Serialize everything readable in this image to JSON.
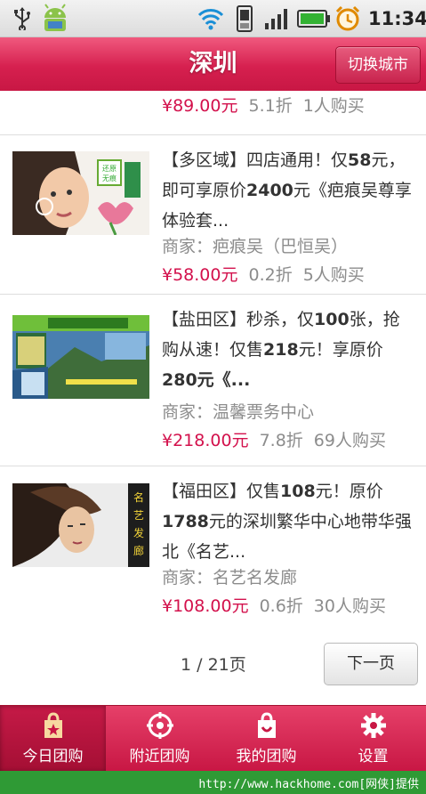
{
  "status_bar": {
    "time": "11:34",
    "icons": [
      "usb-icon",
      "android-debug-icon",
      "wifi-icon",
      "phone-icon",
      "signal-icon",
      "battery-icon",
      "alarm-clock-icon"
    ]
  },
  "header": {
    "city": "深圳",
    "switch_city_label": "切换城市"
  },
  "partial_item": {
    "price": "¥89.00元",
    "discount": "5.1折",
    "buyers": "1人购买"
  },
  "deals": [
    {
      "title_prefix": "【多区域】四店通用！仅",
      "title_num1": "58",
      "title_mid1": "元，即可享原价",
      "title_num2": "2400",
      "title_rest": "元《疤痕吴尊享体验套...",
      "merchant": "商家：疤痕吴（巴恒吴）",
      "price": "¥58.00元",
      "discount": "0.2折",
      "buyers": "5人购买",
      "image": "scar-treatment-promo"
    },
    {
      "title_prefix": "【盐田区】秒杀，仅",
      "title_num1": "100",
      "title_mid1": "张，抢购从速！仅售",
      "title_num2": "218",
      "title_rest": "元！享原价",
      "title_num3": "280",
      "title_end": "元《...",
      "merchant": "商家：温馨票务中心",
      "price": "¥218.00元",
      "discount": "7.8折",
      "buyers": "69人购买",
      "image": "scenic-tour-tickets"
    },
    {
      "title_prefix": "【福田区】仅售",
      "title_num1": "108",
      "title_mid1": "元！原价",
      "title_num2": "1788",
      "title_rest": "元的深圳繁华中心地带华强北《名艺...",
      "merchant": "商家：名艺名发廊",
      "price": "¥108.00元",
      "discount": "0.6折",
      "buyers": "30人购买",
      "image": "hair-salon-model"
    }
  ],
  "pagination": {
    "indicator": "1 / 21页",
    "next_label": "下一页"
  },
  "tabs": [
    {
      "label": "今日团购",
      "icon": "today-deals-icon",
      "active": true
    },
    {
      "label": "附近团购",
      "icon": "nearby-icon",
      "active": false
    },
    {
      "label": "我的团购",
      "icon": "my-deals-bag-icon",
      "active": false
    },
    {
      "label": "设置",
      "icon": "gear-icon",
      "active": false
    }
  ],
  "watermark": "http://www.hackhome.com[网侠]提供",
  "colors": {
    "accent": "#d3114c",
    "header_pink": "#d6204f",
    "tab_pink": "#c81744",
    "watermark_green": "#2f9a35"
  }
}
